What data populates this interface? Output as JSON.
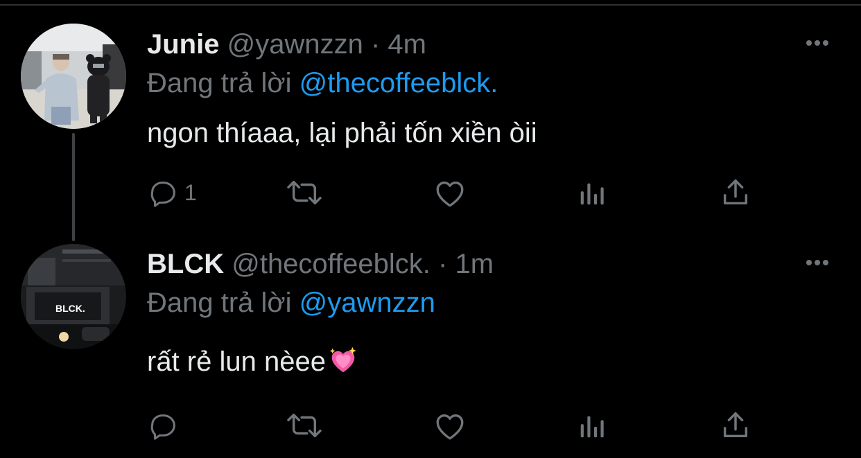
{
  "tweets": [
    {
      "display_name": "Junie",
      "handle": "@yawnzzn",
      "separator": "·",
      "time": "4m",
      "reply_prefix": "Đang trả lời",
      "reply_to": "@thecoffeeblck.",
      "text": "ngon thíaaa, lại phải tốn xiền òii",
      "reply_count": "1",
      "avatar_icon": "person-photo-avatar"
    },
    {
      "display_name": "BLCK",
      "handle": "@thecoffeeblck.",
      "separator": "·",
      "time": "1m",
      "reply_prefix": "Đang trả lời",
      "reply_to": "@yawnzzn",
      "text": "rất rẻ lun nèee",
      "text_emoji": "sparkling-heart-emoji",
      "reply_count": "",
      "avatar_icon": "cafe-photo-avatar",
      "avatar_sign": "BLCK."
    }
  ],
  "colors": {
    "background": "#000000",
    "primary_text": "#e7e9ea",
    "secondary_text": "#71767b",
    "accent": "#1d9bf0",
    "thread_line": "#3e4144"
  }
}
